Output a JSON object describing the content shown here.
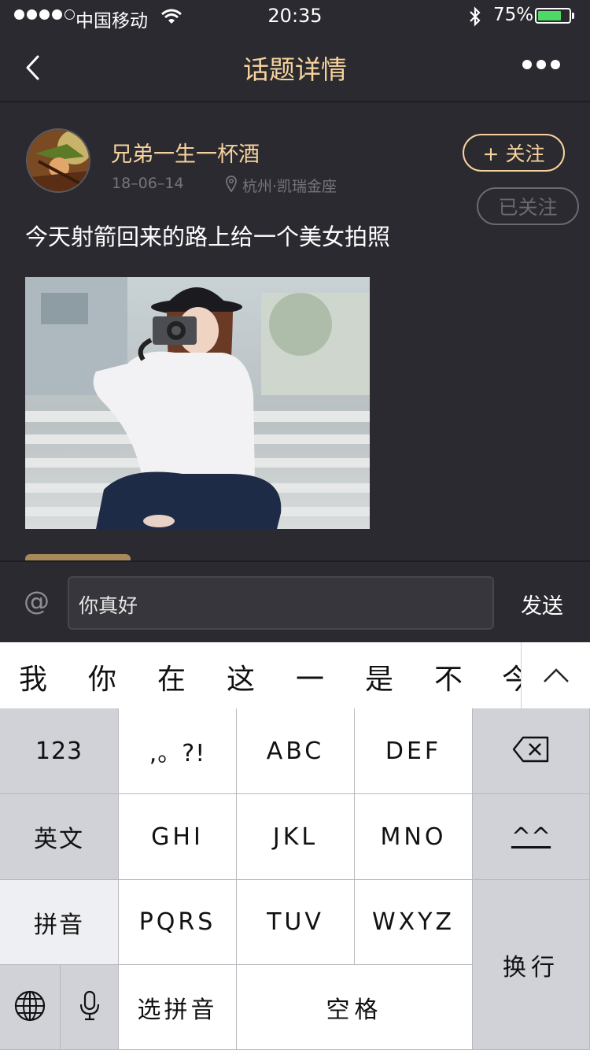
{
  "status_bar": {
    "carrier": "中国移动",
    "time": "20:35",
    "battery": "75%",
    "battery_level": 0.75,
    "signal_bars": 4
  },
  "nav": {
    "title": "话题详情",
    "back_icon": "chevron-left-icon",
    "more_icon": "more-dots-icon"
  },
  "post": {
    "username": "兄弟一生一杯酒",
    "date": "18–06–14",
    "location": "杭州·凯瑞金座",
    "follow_label": "+ 关注",
    "followed_label": "已关注",
    "text": "今天射箭回来的路上给一个美女拍照"
  },
  "comment": {
    "at_symbol": "@",
    "value": "你真好",
    "send_label": "发送"
  },
  "keyboard": {
    "candidates": [
      "我",
      "你",
      "在",
      "这",
      "一",
      "是",
      "不",
      "今"
    ],
    "rows": {
      "num": "123",
      "punct": ",。?!",
      "abc": "ABC",
      "def": "DEF",
      "english": "英文",
      "ghi": "GHI",
      "jkl": "JKL",
      "mno": "MNO",
      "emoticon": "^^",
      "pinyin": "拼音",
      "pqrs": "PQRS",
      "tuv": "TUV",
      "wxyz": "WXYZ",
      "newline": "换行",
      "select_pinyin": "选拼音",
      "space": "空格"
    }
  },
  "colors": {
    "accent": "#f6d39c",
    "background": "#2b2a30",
    "muted": "#76747c"
  }
}
